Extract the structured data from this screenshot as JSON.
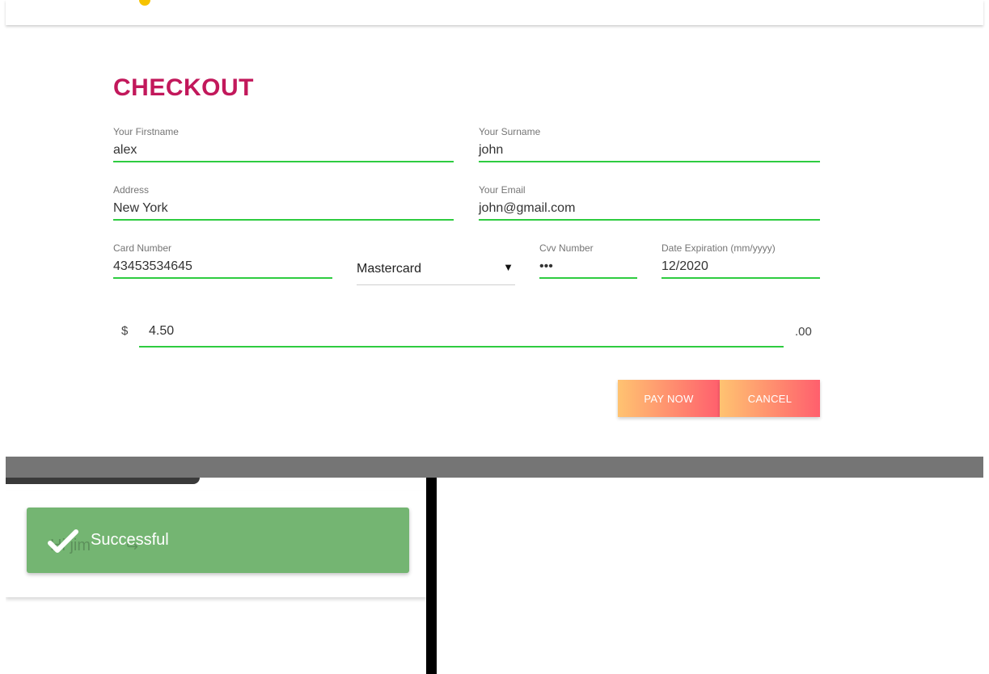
{
  "checkout": {
    "title": "CHECKOUT",
    "firstname": {
      "label": "Your Firstname",
      "value": "alex"
    },
    "surname": {
      "label": "Your Surname",
      "value": "john"
    },
    "address": {
      "label": "Address",
      "value": "New York"
    },
    "email": {
      "label": "Your Email",
      "value": "john@gmail.com"
    },
    "card_number": {
      "label": "Card Number",
      "value": "43453534645"
    },
    "card_type": {
      "value": "Mastercard",
      "arrow": "▼"
    },
    "cvv": {
      "label": "Cvv Number",
      "value": "•••"
    },
    "expiration": {
      "label": "Date Expiration (mm/yyyy)",
      "value": "12/2020"
    },
    "amount": {
      "prefix": "$",
      "value": "4.50",
      "suffix": ".00"
    },
    "buttons": {
      "pay": "PAY NOW",
      "cancel": "CANCEL"
    }
  },
  "toast": {
    "message": "Successful",
    "underlying_text": "Hi jim",
    "underlying_icon": "↪"
  },
  "colors": {
    "title": "#c2185b",
    "underline": "#2ecc40",
    "button_gradient_start": "#ffc371",
    "button_gradient_end": "#ff5f6d",
    "toast_bg": "#74b572",
    "logo": "#f6c300"
  },
  "icons": {
    "logo": "logo-icon",
    "toast": "check-icon",
    "select": "chevron-down-icon",
    "underlying": "logout-icon"
  }
}
